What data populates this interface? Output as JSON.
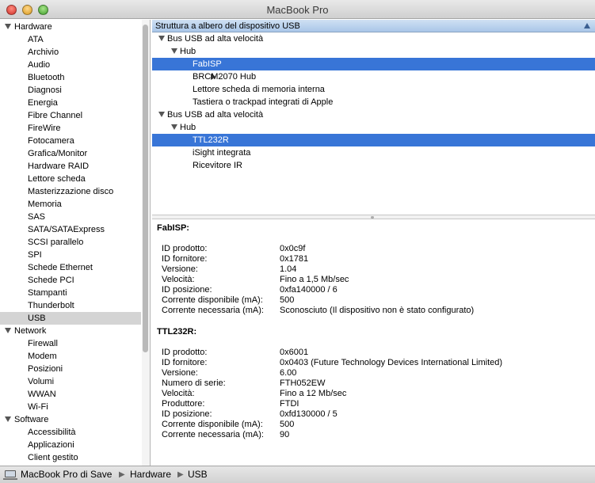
{
  "window": {
    "title": "MacBook Pro"
  },
  "sidebar": {
    "rows": [
      {
        "kind": "group",
        "label": "Hardware"
      },
      {
        "kind": "item",
        "label": "ATA"
      },
      {
        "kind": "item",
        "label": "Archivio"
      },
      {
        "kind": "item",
        "label": "Audio"
      },
      {
        "kind": "item",
        "label": "Bluetooth"
      },
      {
        "kind": "item",
        "label": "Diagnosi"
      },
      {
        "kind": "item",
        "label": "Energia"
      },
      {
        "kind": "item",
        "label": "Fibre Channel"
      },
      {
        "kind": "item",
        "label": "FireWire"
      },
      {
        "kind": "item",
        "label": "Fotocamera"
      },
      {
        "kind": "item",
        "label": "Grafica/Monitor"
      },
      {
        "kind": "item",
        "label": "Hardware RAID"
      },
      {
        "kind": "item",
        "label": "Lettore scheda"
      },
      {
        "kind": "item",
        "label": "Masterizzazione disco"
      },
      {
        "kind": "item",
        "label": "Memoria"
      },
      {
        "kind": "item",
        "label": "SAS"
      },
      {
        "kind": "item",
        "label": "SATA/SATAExpress"
      },
      {
        "kind": "item",
        "label": "SCSI parallelo"
      },
      {
        "kind": "item",
        "label": "SPI"
      },
      {
        "kind": "item",
        "label": "Schede Ethernet"
      },
      {
        "kind": "item",
        "label": "Schede PCI"
      },
      {
        "kind": "item",
        "label": "Stampanti"
      },
      {
        "kind": "item",
        "label": "Thunderbolt"
      },
      {
        "kind": "item",
        "label": "USB",
        "selected": true
      },
      {
        "kind": "group",
        "label": "Network"
      },
      {
        "kind": "item",
        "label": "Firewall"
      },
      {
        "kind": "item",
        "label": "Modem"
      },
      {
        "kind": "item",
        "label": "Posizioni"
      },
      {
        "kind": "item",
        "label": "Volumi"
      },
      {
        "kind": "item",
        "label": "WWAN"
      },
      {
        "kind": "item",
        "label": "Wi-Fi"
      },
      {
        "kind": "group",
        "label": "Software"
      },
      {
        "kind": "item",
        "label": "Accessibilità"
      },
      {
        "kind": "item",
        "label": "Applicazioni"
      },
      {
        "kind": "item",
        "label": "Client gestito"
      }
    ]
  },
  "tree": {
    "header": "Struttura a albero del dispositivo USB",
    "rows": [
      {
        "label": "Bus USB ad alta velocità",
        "level": 0,
        "toggle": "down"
      },
      {
        "label": "Hub",
        "level": 1,
        "toggle": "down"
      },
      {
        "label": "FabISP",
        "level": 2,
        "toggle": "none",
        "selected": true
      },
      {
        "label": "BRCM2070 Hub",
        "level": 2,
        "toggle": "right"
      },
      {
        "label": "Lettore scheda di memoria interna",
        "level": 2,
        "toggle": "none"
      },
      {
        "label": "Tastiera o trackpad integrati di Apple",
        "level": 2,
        "toggle": "none"
      },
      {
        "label": "Bus USB ad alta velocità",
        "level": 0,
        "toggle": "down"
      },
      {
        "label": "Hub",
        "level": 1,
        "toggle": "down"
      },
      {
        "label": "TTL232R",
        "level": 2,
        "toggle": "none",
        "selected": true
      },
      {
        "label": "iSight integrata",
        "level": 2,
        "toggle": "none"
      },
      {
        "label": "Ricevitore IR",
        "level": 2,
        "toggle": "none"
      }
    ]
  },
  "details": {
    "devices": [
      {
        "title": "FabISP:",
        "props": [
          {
            "key": "ID prodotto:",
            "value": "0x0c9f"
          },
          {
            "key": "ID fornitore:",
            "value": "0x1781"
          },
          {
            "key": "Versione:",
            "value": " 1.04"
          },
          {
            "key": "Velocità:",
            "value": "Fino a 1,5 Mb/sec"
          },
          {
            "key": "ID posizione:",
            "value": "0xfa140000 / 6"
          },
          {
            "key": "Corrente disponibile (mA):",
            "value": "500"
          },
          {
            "key": "Corrente necessaria (mA):",
            "value": "Sconosciuto (Il dispositivo non è stato configurato)"
          }
        ]
      },
      {
        "title": "TTL232R:",
        "props": [
          {
            "key": "ID prodotto:",
            "value": "0x6001"
          },
          {
            "key": "ID fornitore:",
            "value": "0x0403  (Future Technology Devices International Limited)"
          },
          {
            "key": "Versione:",
            "value": " 6.00"
          },
          {
            "key": "Numero di serie:",
            "value": "FTH052EW"
          },
          {
            "key": "Velocità:",
            "value": "Fino a 12 Mb/sec"
          },
          {
            "key": "Produttore:",
            "value": "FTDI"
          },
          {
            "key": "ID posizione:",
            "value": "0xfd130000 / 5"
          },
          {
            "key": "Corrente disponibile (mA):",
            "value": "500"
          },
          {
            "key": "Corrente necessaria (mA):",
            "value": "90"
          }
        ]
      }
    ]
  },
  "pathbar": {
    "icon": "laptop-icon",
    "crumbs": [
      "MacBook Pro di Save",
      "Hardware",
      "USB"
    ]
  },
  "colors": {
    "selection_active": "#3875d7",
    "selection_inactive": "#d4d4d4",
    "header_blue": "#a9c6e8"
  }
}
